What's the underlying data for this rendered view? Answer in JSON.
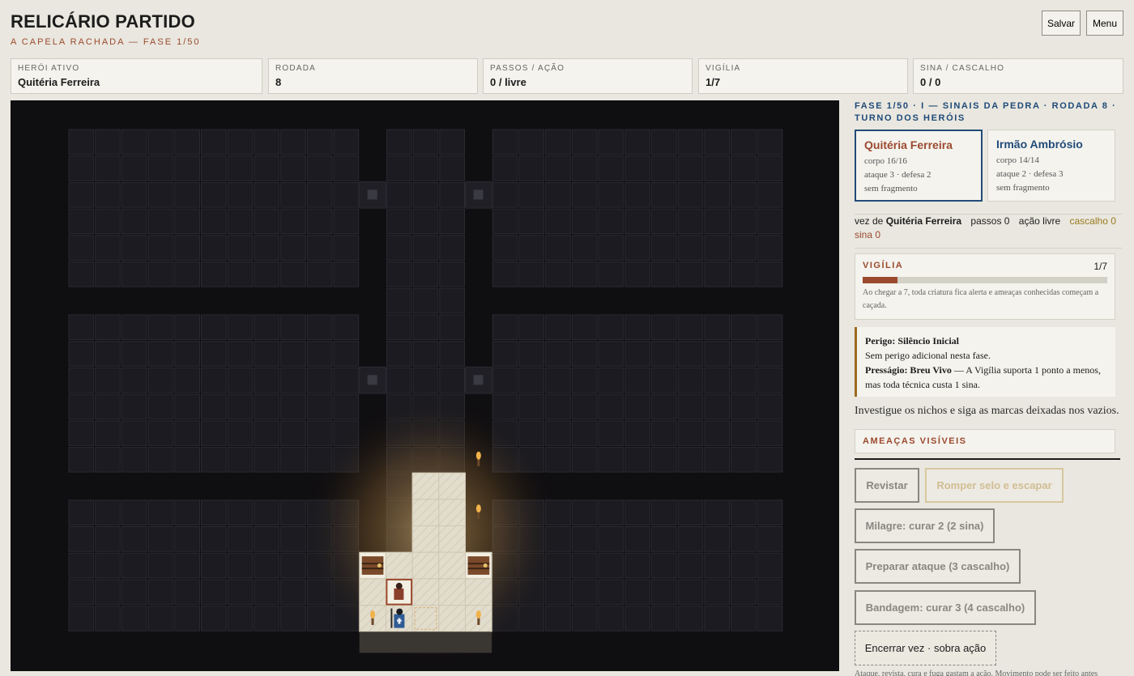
{
  "header": {
    "title": "RELICÁRIO PARTIDO",
    "subtitle": "A CAPELA RACHADA — FASE 1/50",
    "save_label": "Salvar",
    "menu_label": "Menu"
  },
  "stats": [
    {
      "label": "HERÓI ATIVO",
      "value": "Quitéria Ferreira"
    },
    {
      "label": "RODADA",
      "value": "8"
    },
    {
      "label": "PASSOS / AÇÃO",
      "value": "0 / livre"
    },
    {
      "label": "VIGÍLIA",
      "value": "1/7"
    },
    {
      "label": "SINA / CASCALHO",
      "value": "0 / 0"
    }
  ],
  "panel": {
    "phase": "FASE 1/50 · I — SINAIS DA PEDRA · RODADA 8 · TURNO DOS HERÓIS",
    "heroes": [
      {
        "name": "Quitéria Ferreira",
        "body": "corpo 16/16",
        "stats": "ataque 3 · defesa 2",
        "fragment": "sem fragmento",
        "color": "#9b4a2f",
        "active": true
      },
      {
        "name": "Irmão Ambrósio",
        "body": "corpo 14/14",
        "stats": "ataque 2 · defesa 3",
        "fragment": "sem fragmento",
        "color": "#234b78",
        "active": false
      }
    ],
    "turn": {
      "prefix": "vez de",
      "hero": "Quitéria Ferreira",
      "steps": "passos 0",
      "action": "ação livre",
      "gravel": "cascalho 0",
      "fate": "sina 0"
    },
    "vigil": {
      "title": "VIGÍLIA",
      "count": "1/7",
      "level": 1,
      "max": 7,
      "note": "Ao chegar a 7, toda criatura fica alerta e ameaças conhecidas começam a caçada."
    },
    "danger": {
      "peril_label": "Perigo: Silêncio Inicial",
      "peril_text": "Sem perigo adicional nesta fase.",
      "omen_label": "Presságio: Breu Vivo",
      "omen_text": " — A Vigília suporta 1 ponto a menos, mas toda técnica custa 1 sina."
    },
    "hint": "Investigue os nichos e siga as marcas deixadas nos vazios.",
    "threats_title": "AMEAÇAS VISÍVEIS",
    "actions": {
      "search": "Revistar",
      "break_seal": "Romper selo e escapar",
      "miracle": "Milagre: curar 2 (2 sina)",
      "prepare": "Preparar ataque (3 cascalho)",
      "bandage": "Bandagem: curar 3 (4 cascalho)",
      "end_turn": "Encerrar vez · sobra ação"
    },
    "footnote": "Ataque, revista, cura e fuga gastam a ação. Movimento pode ser feito antes"
  },
  "board": {
    "colors": {
      "background": "#0f0e11",
      "dark_tile": "#1b1b21",
      "dark_tile_border": "#2a2a31",
      "lit_floor": "#e2dccc",
      "torch": "#f0b24a"
    },
    "icons": [
      "chest-icon",
      "chest-icon",
      "hero-quiteria-token",
      "hero-ambrosio-token",
      "torch-icon",
      "torch-icon",
      "torch-icon",
      "torch-icon",
      "pillar-icon"
    ]
  }
}
